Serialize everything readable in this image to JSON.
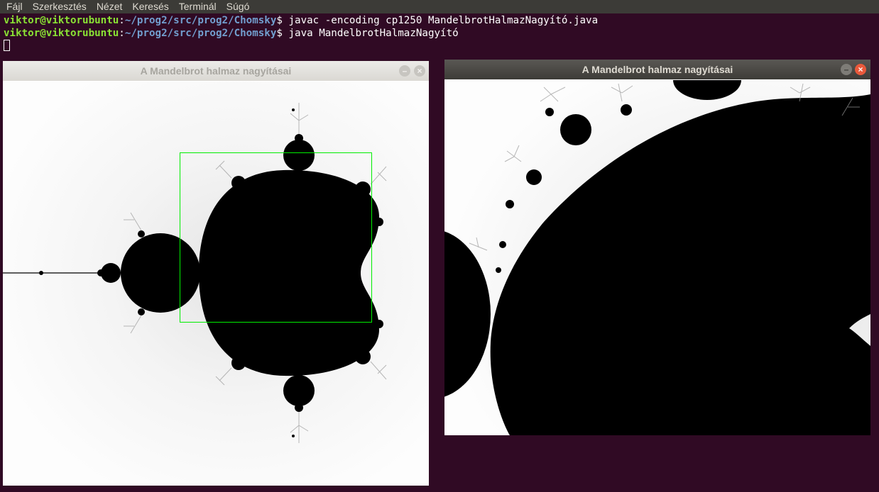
{
  "menu": [
    "Fájl",
    "Szerkesztés",
    "Nézet",
    "Keresés",
    "Terminál",
    "Súgó"
  ],
  "terminal": {
    "line1": {
      "userhost": "viktor@viktorubuntu",
      "sep": ":",
      "path": "~/prog2/src/prog2/Chomsky",
      "prompt": "$ ",
      "command": "javac -encoding cp1250 MandelbrotHalmazNagyító.java"
    },
    "line2": {
      "userhost": "viktor@viktorubuntu",
      "sep": ":",
      "path": "~/prog2/src/prog2/Chomsky",
      "prompt": "$ ",
      "command": "java MandelbrotHalmazNagyító"
    }
  },
  "window_left": {
    "title": "A Mandelbrot halmaz nagyításai",
    "min_glyph": "–",
    "close_glyph": "×"
  },
  "window_right": {
    "title": "A Mandelbrot halmaz nagyításai",
    "min_glyph": "–",
    "close_glyph": "×"
  },
  "colors": {
    "terminal_bg": "#300a24",
    "user": "#8ae234",
    "path": "#729fcf",
    "selection": "#00ee00",
    "close_button": "#e9593b"
  }
}
